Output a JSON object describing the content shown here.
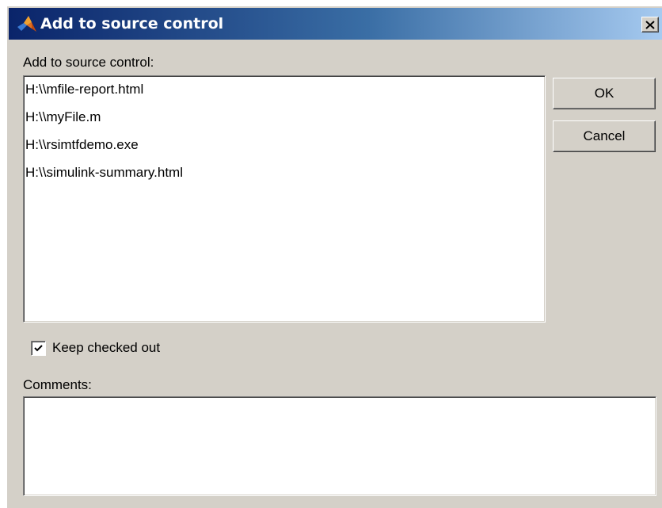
{
  "window": {
    "title": "Add to source control",
    "close_label": "×"
  },
  "main": {
    "list_label": "Add to source control:",
    "files": [
      "H:\\\\mfile-report.html",
      "H:\\\\myFile.m",
      "H:\\\\rsimtfdemo.exe",
      "H:\\\\simulink-summary.html"
    ],
    "keep_checked_out": {
      "label": "Keep checked out",
      "checked": true
    },
    "comments_label": "Comments:",
    "comments_value": ""
  },
  "buttons": {
    "ok": "OK",
    "cancel": "Cancel"
  },
  "colors": {
    "titlebar_start": "#0a246a",
    "titlebar_end": "#a6caf0",
    "dialog_bg": "#d4d0c8"
  },
  "icons": {
    "app": "matlab-logo-icon",
    "close": "close-icon",
    "check": "checkmark-icon"
  }
}
